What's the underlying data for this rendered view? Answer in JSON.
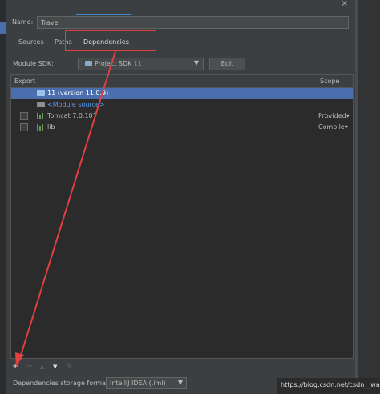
{
  "name": {
    "label": "Name:",
    "value": "Travel"
  },
  "tabs": [
    {
      "label": "Sources"
    },
    {
      "label": "Paths"
    },
    {
      "label": "Dependencies"
    }
  ],
  "module_sdk": {
    "label": "Module SDK:",
    "value": "Project SDK",
    "version": "11",
    "edit_label": "Edit"
  },
  "table": {
    "headers": {
      "export": "Export",
      "scope": "Scope"
    },
    "rows": [
      {
        "text": "11 (version 11.0.9)",
        "scope": ""
      },
      {
        "text": "<Module source>",
        "scope": ""
      },
      {
        "text": "Tomcat 7.0.107",
        "scope": "Provided"
      },
      {
        "text": "lib",
        "scope": "Compile"
      }
    ]
  },
  "toolbar": {
    "add": "+",
    "remove": "−",
    "up": "▲",
    "down": "▼",
    "edit": "✎"
  },
  "storage_format": {
    "label": "Dependencies storage format:",
    "value": "IntelliJ IDEA (.iml)"
  },
  "watermark": "https://blog.csdn.net/csdn__wang",
  "colors": {
    "selection": "#4b6eaf",
    "annotation": "#e04040",
    "link": "#589df6"
  },
  "icons": {
    "close": "close-icon",
    "dropdown": "chevron-down-icon"
  }
}
